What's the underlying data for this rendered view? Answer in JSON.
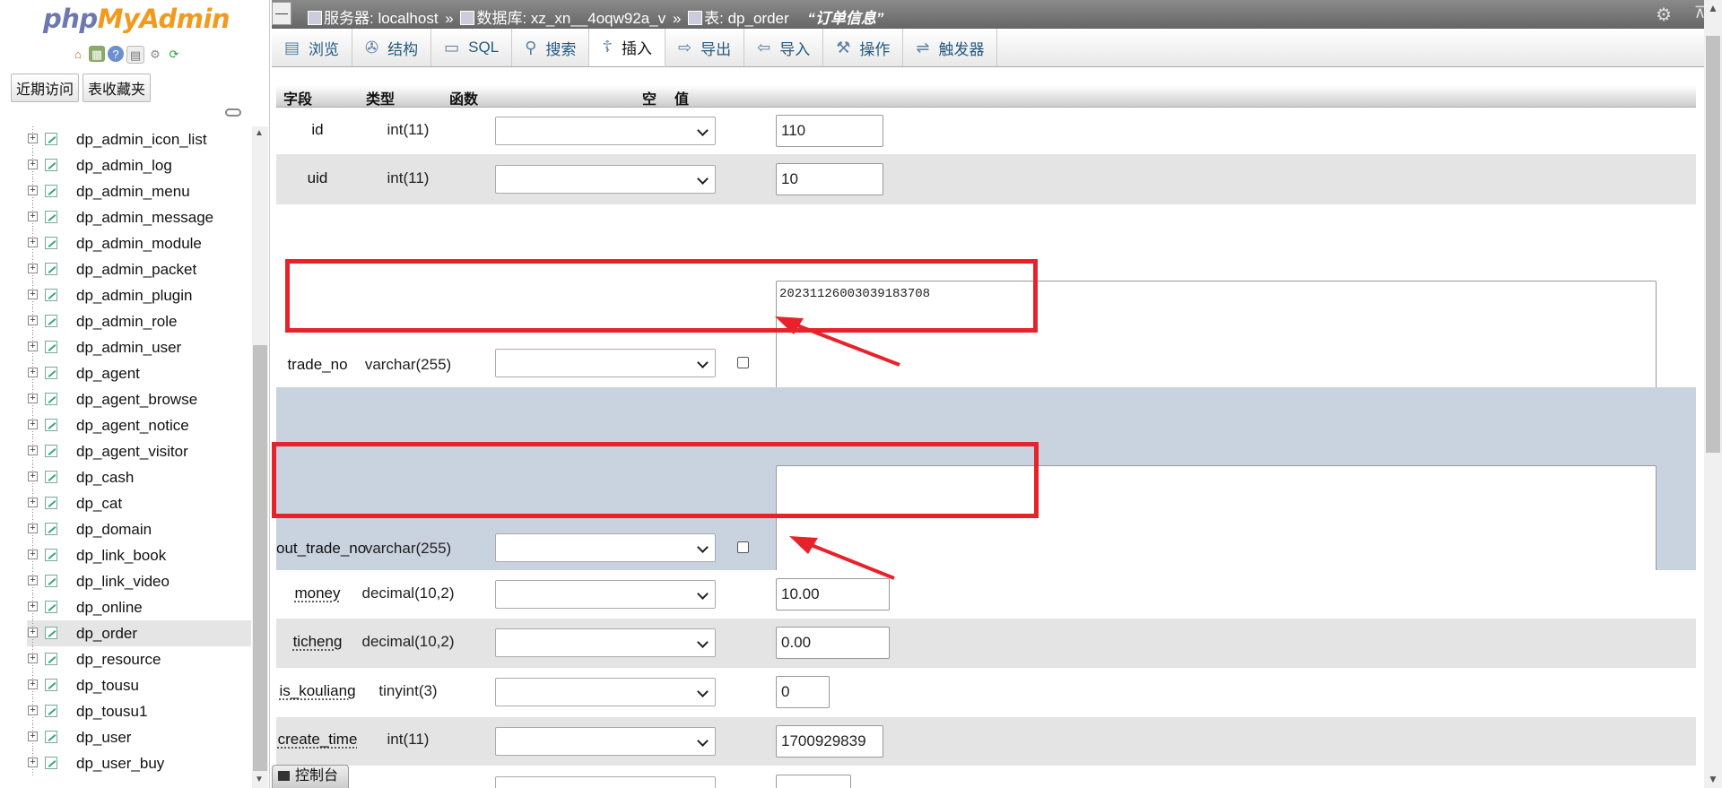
{
  "app": {
    "logo_php": "php",
    "logo_admin": "MyAdmin",
    "nav_icons": [
      "home-icon",
      "database-icon",
      "help-icon",
      "docs-icon",
      "settings-icon",
      "reload-icon"
    ]
  },
  "nav": {
    "tabs": [
      "近期访问",
      "表收藏夹"
    ],
    "tables": [
      "dp_admin_icon_list",
      "dp_admin_log",
      "dp_admin_menu",
      "dp_admin_message",
      "dp_admin_module",
      "dp_admin_packet",
      "dp_admin_plugin",
      "dp_admin_role",
      "dp_admin_user",
      "dp_agent",
      "dp_agent_browse",
      "dp_agent_notice",
      "dp_agent_visitor",
      "dp_cash",
      "dp_cat",
      "dp_domain",
      "dp_link_book",
      "dp_link_video",
      "dp_online",
      "dp_order",
      "dp_resource",
      "dp_tousu",
      "dp_tousu1",
      "dp_user",
      "dp_user_buy"
    ],
    "active_table": "dp_order"
  },
  "breadcrumb": {
    "server": "服务器: localhost",
    "database": "数据库: xz_xn__4oqw92a_v",
    "table": "表: dp_order",
    "comment": "“订单信息”",
    "sep": "»"
  },
  "tabs": [
    {
      "label": "浏览",
      "icon": "browse-icon"
    },
    {
      "label": "结构",
      "icon": "structure-icon"
    },
    {
      "label": "SQL",
      "icon": "sql-icon"
    },
    {
      "label": "搜索",
      "icon": "search-icon"
    },
    {
      "label": "插入",
      "icon": "insert-icon"
    },
    {
      "label": "导出",
      "icon": "export-icon"
    },
    {
      "label": "导入",
      "icon": "import-icon"
    },
    {
      "label": "操作",
      "icon": "operations-icon"
    },
    {
      "label": "触发器",
      "icon": "triggers-icon"
    }
  ],
  "active_tab": "插入",
  "table": {
    "headers": {
      "field": "字段",
      "type": "类型",
      "function": "函数",
      "null": "空",
      "value": "值"
    },
    "rows": [
      {
        "field": "id",
        "type": "int(11)",
        "value": "110"
      },
      {
        "field": "uid",
        "type": "int(11)",
        "value": "10"
      },
      {
        "field": "trade_no",
        "type": "varchar(255)",
        "value": "20231126003039183708",
        "nullable": true
      },
      {
        "field": "out_trade_no",
        "type": "varchar(255)",
        "value": "",
        "nullable": true
      },
      {
        "field": "money",
        "type": "decimal(10,2)",
        "value": "10.00"
      },
      {
        "field": "ticheng",
        "type": "decimal(10,2)",
        "value": "0.00"
      },
      {
        "field": "is_kouliang",
        "type": "tinyint(3)",
        "value": "0"
      },
      {
        "field": "create_time",
        "type": "int(11)",
        "value": "1700929839"
      }
    ]
  },
  "console": {
    "label": "控制台"
  },
  "colors": {
    "annotation_red": "#e8222a",
    "link_blue": "#235a81",
    "highlight_row": "#c9d3e0"
  }
}
